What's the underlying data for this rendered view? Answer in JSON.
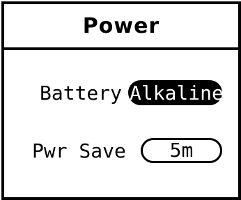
{
  "screen": {
    "title": "Power"
  },
  "settings": [
    {
      "label": "Battery",
      "value": "Alkaline",
      "selected": true
    },
    {
      "label": "Pwr Save",
      "value": "5m",
      "selected": false
    }
  ],
  "colors": {
    "foreground": "#000000",
    "background": "#ffffff",
    "selected_text": "#ffffff"
  }
}
